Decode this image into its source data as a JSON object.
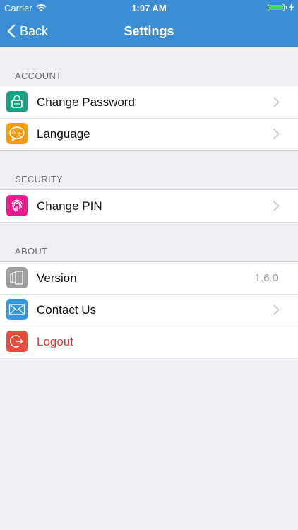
{
  "status": {
    "carrier": "Carrier",
    "time": "1:07 AM"
  },
  "nav": {
    "back_label": "Back",
    "title": "Settings"
  },
  "sections": {
    "account": {
      "label": "ACCOUNT",
      "items": [
        {
          "label": "Change Password",
          "icon": "lock-icon",
          "color": "#1fa085"
        },
        {
          "label": "Language",
          "icon": "translate-icon",
          "color": "#f39c12"
        }
      ]
    },
    "security": {
      "label": "SECURITY",
      "items": [
        {
          "label": "Change PIN",
          "icon": "fingerprint-icon",
          "color": "#e91e8c"
        }
      ]
    },
    "about": {
      "label": "ABOUT",
      "items": [
        {
          "label": "Version",
          "value": "1.6.0",
          "icon": "version-icon",
          "color": "#9e9e9e"
        },
        {
          "label": "Contact Us",
          "icon": "mail-icon",
          "color": "#3498db"
        },
        {
          "label": "Logout",
          "icon": "logout-icon",
          "color": "#e74c3c"
        }
      ]
    }
  },
  "colors": {
    "nav_bar": "#3b8ed6",
    "background": "#efeff4",
    "danger_text": "#e8352a"
  }
}
